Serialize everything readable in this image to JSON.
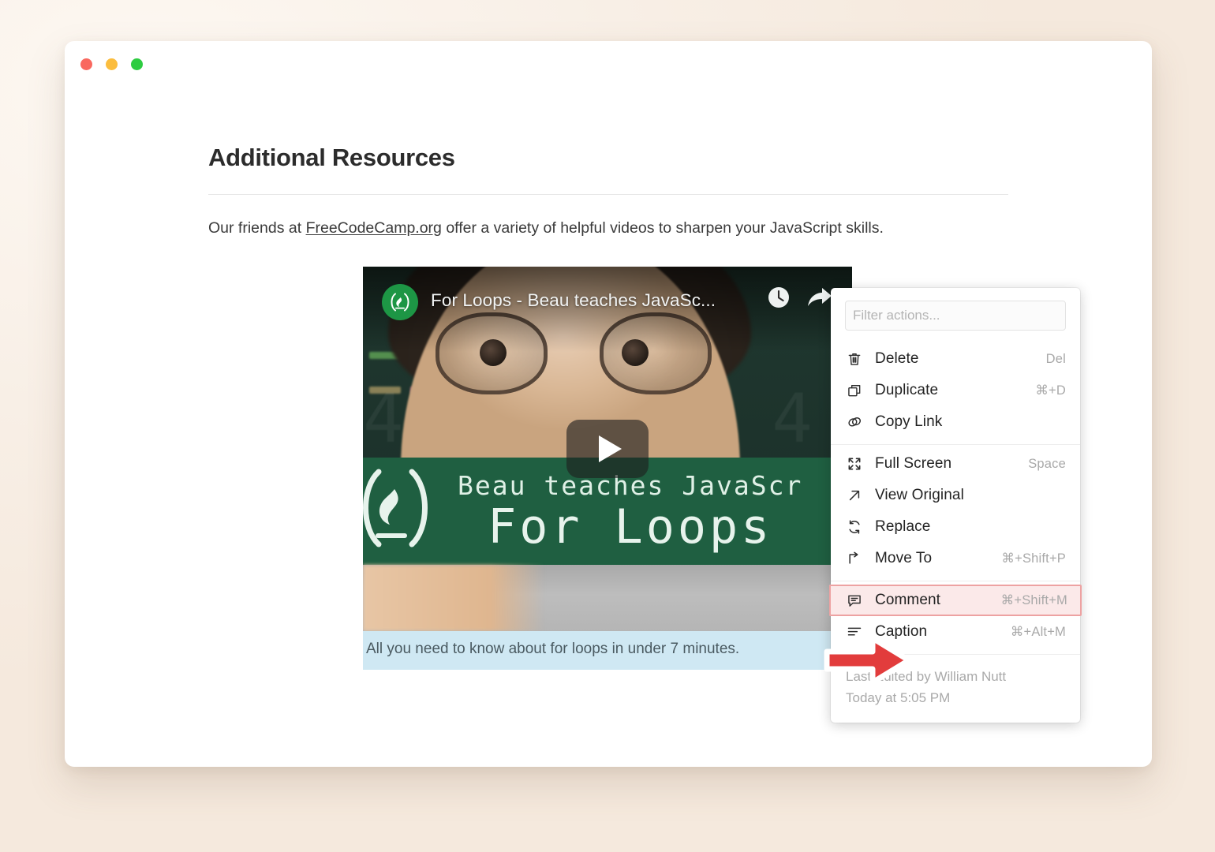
{
  "window": {
    "traffic_lights": [
      {
        "name": "close",
        "color": "#f9685f"
      },
      {
        "name": "minimize",
        "color": "#fbbd3e"
      },
      {
        "name": "maximize",
        "color": "#2ecc41"
      }
    ]
  },
  "document": {
    "title": "Additional Resources",
    "paragraph": {
      "before_link": "Our friends at ",
      "link_text": "FreeCodeCamp.org",
      "after_link": " offer a variety of helpful videos to sharpen your JavaScript skills."
    }
  },
  "video": {
    "title": "For Loops - Beau teaches JavaSc...",
    "avatar_icon": "freecodecamp-flame-icon",
    "watch_later_icon": "clock-icon",
    "share_icon": "share-arrow-icon",
    "play_icon": "play-icon",
    "banner_line1": "Beau teaches JavaScr",
    "banner_line2": "For Loops",
    "ghost_digits": "4 4 4 4 4 4 4 4 4 4 4 4 4",
    "caption": "All you need to know about for loops in under 7 minutes.",
    "caption_highlight_color": "#cfe8f3"
  },
  "context_menu": {
    "filter": {
      "value": "",
      "placeholder": "Filter actions..."
    },
    "groups": [
      {
        "items": [
          {
            "icon": "trash-icon",
            "label": "Delete",
            "shortcut": "Del"
          },
          {
            "icon": "duplicate-icon",
            "label": "Duplicate",
            "shortcut": "⌘+D"
          },
          {
            "icon": "link-icon",
            "label": "Copy Link",
            "shortcut": ""
          }
        ]
      },
      {
        "items": [
          {
            "icon": "expand-icon",
            "label": "Full Screen",
            "shortcut": "Space"
          },
          {
            "icon": "arrow-up-right-icon",
            "label": "View Original",
            "shortcut": ""
          },
          {
            "icon": "refresh-icon",
            "label": "Replace",
            "shortcut": ""
          },
          {
            "icon": "move-to-icon",
            "label": "Move To",
            "shortcut": "⌘+Shift+P"
          }
        ]
      },
      {
        "items": [
          {
            "icon": "comment-icon",
            "label": "Comment",
            "shortcut": "⌘+Shift+M",
            "highlighted": true
          },
          {
            "icon": "caption-icon",
            "label": "Caption",
            "shortcut": "⌘+Alt+M"
          }
        ]
      }
    ],
    "footer": {
      "line1": "Last Edited by William Nutt",
      "line2": "Today at 5:05 PM"
    },
    "highlight_color": "#fbe9e9",
    "highlight_border_color": "#eda2a2"
  },
  "annotation": {
    "arrow_icon": "right-arrow-annotation",
    "color": "#e23c3c"
  }
}
